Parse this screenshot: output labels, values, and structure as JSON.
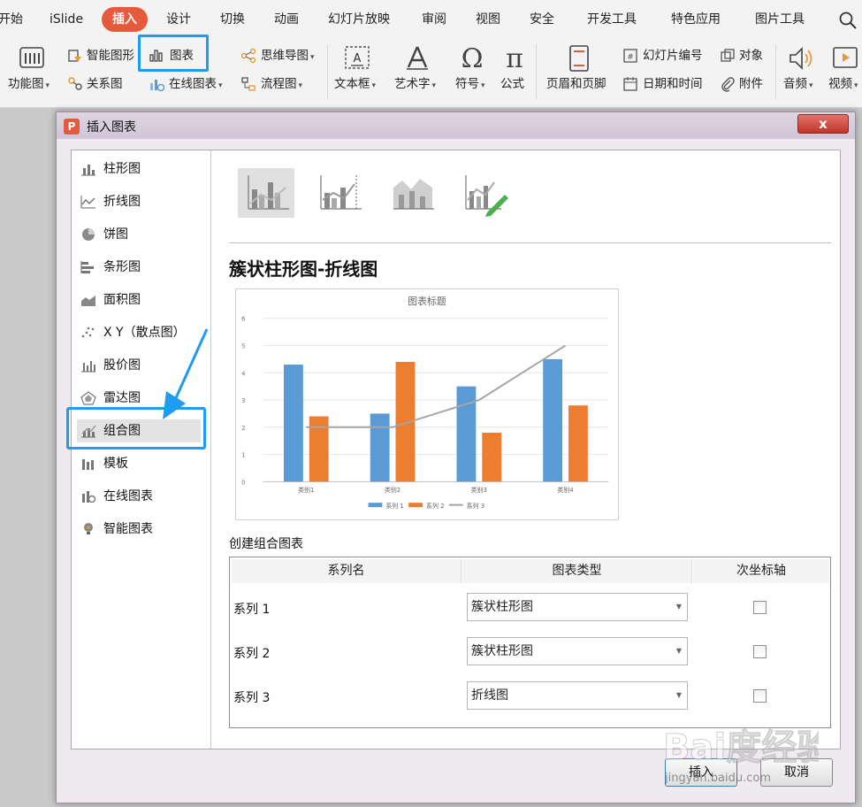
{
  "ribbon": {
    "tabs": [
      "开始",
      "iSlide",
      "插入",
      "设计",
      "切换",
      "动画",
      "幻灯片放映",
      "审阅",
      "视图",
      "安全",
      "开发工具",
      "特色应用",
      "图片工具"
    ],
    "active_tab": "插入",
    "groups": {
      "function_chart": "功能图",
      "smart_shape": "智能图形",
      "chart": "图表",
      "relation_chart": "关系图",
      "online_chart": "在线图表",
      "mind_map": "思维导图",
      "flow_chart": "流程图",
      "text_box": "文本框",
      "word_art": "艺术字",
      "symbol": "符号",
      "formula": "公式",
      "header_footer": "页眉和页脚",
      "slide_number": "幻灯片编号",
      "object": "对象",
      "date_time": "日期和时间",
      "attachment": "附件",
      "audio": "音频",
      "video": "视频"
    }
  },
  "dialog": {
    "title": "插入图表",
    "close_label": "x",
    "nav": [
      "柱形图",
      "折线图",
      "饼图",
      "条形图",
      "面积图",
      "X Y（散点图）",
      "股价图",
      "雷达图",
      "组合图",
      "模板",
      "在线图表",
      "智能图表"
    ],
    "selected_nav": "组合图",
    "chart_type_title": "簇状柱形图-折线图",
    "combo_section_label": "创建组合图表",
    "table": {
      "headers": [
        "系列名",
        "图表类型",
        "次坐标轴"
      ],
      "rows": [
        {
          "name": "系列 1",
          "type": "簇状柱形图",
          "secondary": false
        },
        {
          "name": "系列 2",
          "type": "簇状柱形图",
          "secondary": false
        },
        {
          "name": "系列 3",
          "type": "折线图",
          "secondary": false
        }
      ]
    },
    "buttons": {
      "insert": "插入",
      "cancel": "取消"
    }
  },
  "chart_data": {
    "type": "bar",
    "title": "图表标题",
    "categories": [
      "类别1",
      "类别2",
      "类别3",
      "类别4"
    ],
    "series": [
      {
        "name": "系列 1",
        "kind": "bar",
        "color": "#5b9bd5",
        "values": [
          4.3,
          2.5,
          3.5,
          4.5
        ]
      },
      {
        "name": "系列 2",
        "kind": "bar",
        "color": "#ed7d31",
        "values": [
          2.4,
          4.4,
          1.8,
          2.8
        ]
      },
      {
        "name": "系列 3",
        "kind": "line",
        "color": "#a5a5a5",
        "values": [
          2,
          2,
          3,
          5
        ]
      }
    ],
    "ylim": [
      0,
      6
    ],
    "yticks": [
      "0",
      "1",
      "2",
      "3",
      "4",
      "5",
      "6"
    ],
    "grid": true,
    "legend": "bottom"
  },
  "watermark": {
    "brand": "Bai度经验",
    "url": "jingyan.baidu.com"
  },
  "colors": {
    "accent_tab": "#e55a3c",
    "highlight": "#1f9bf0"
  }
}
